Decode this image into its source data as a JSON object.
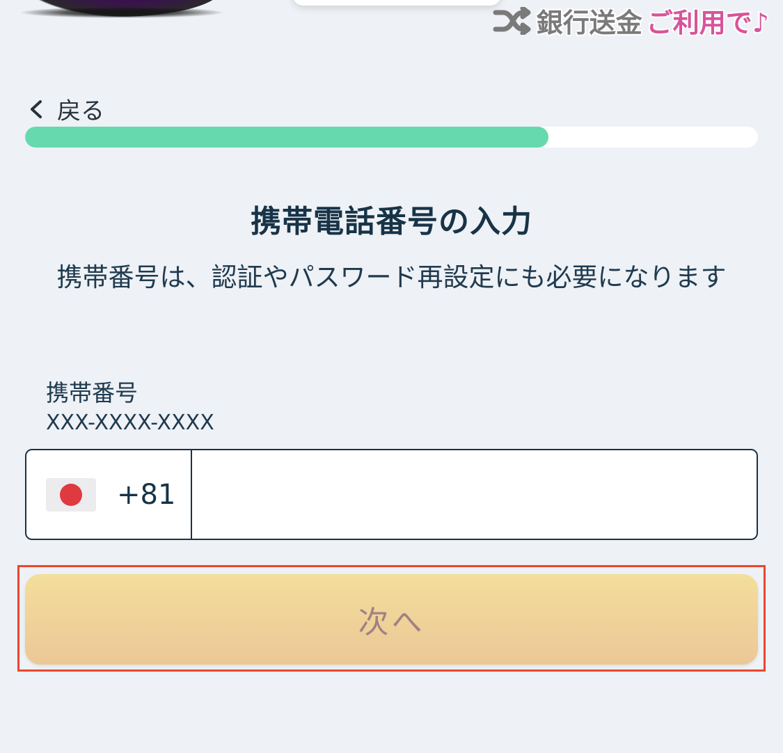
{
  "banner": {
    "bank_text": "銀行送金",
    "use_text": "ご利用で♪",
    "shuffle_icon": "shuffle-icon"
  },
  "back": {
    "label": "戻る",
    "icon": "chevron-left-icon"
  },
  "progress": {
    "value": 0.714,
    "fill_color": "#66d9ae"
  },
  "title": "携帯電話番号の入力",
  "subtitle": "携帯番号は、認証やパスワード再設定にも必要になります",
  "phone_field": {
    "label": "携帯番号",
    "format": "XXX-XXXX-XXXX",
    "country_flag": "japan-flag-icon",
    "dial_code": "+81",
    "value": ""
  },
  "next_button": {
    "label": "次へ",
    "highlight_color": "#e8472e"
  },
  "colors": {
    "background": "#eef1f5",
    "text_dark": "#173347",
    "button_gradient_top": "#f3de9c",
    "button_gradient_bottom": "#ecc796"
  }
}
